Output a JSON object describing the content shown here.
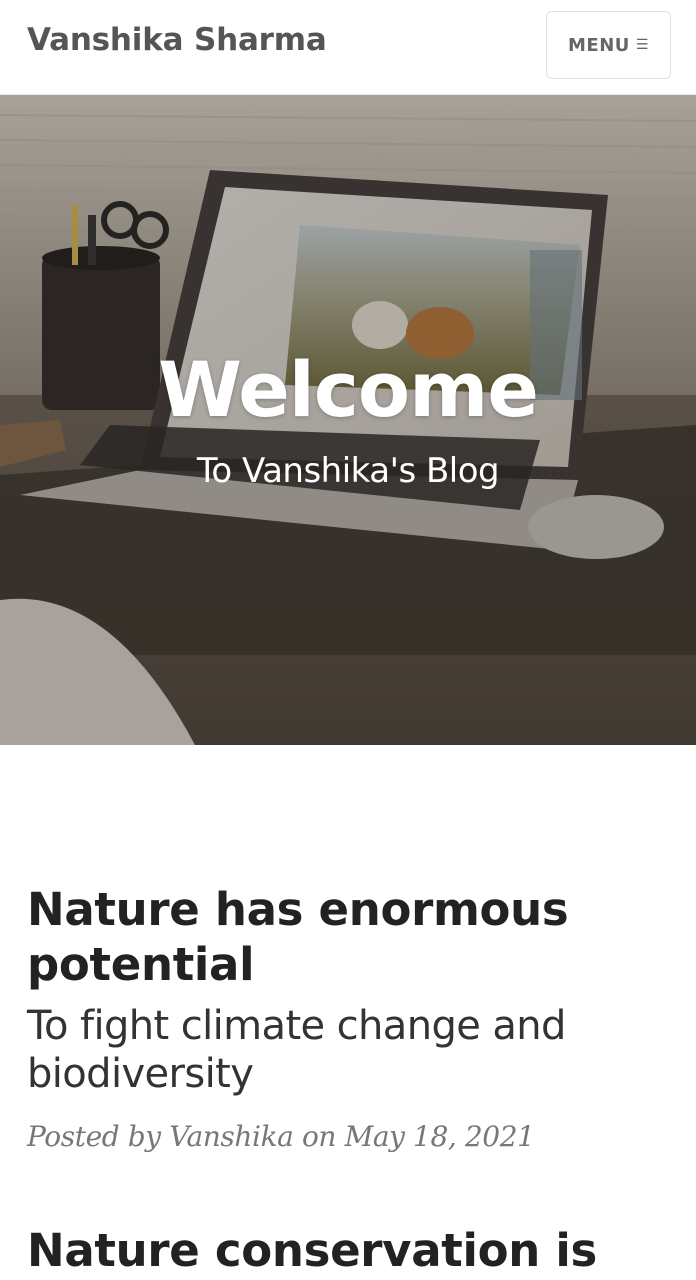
{
  "navbar": {
    "brand": "Vanshika Sharma",
    "menu_label": "MENU",
    "menu_icon": "bars-icon"
  },
  "hero": {
    "title": "Welcome",
    "subtitle": "To Vanshika's Blog"
  },
  "posts": [
    {
      "title": "Nature has enormous potential",
      "subtitle": "To fight climate change and biodiversity",
      "meta_prefix": "Posted by",
      "author": "Vanshika",
      "meta_on": "on",
      "date": "May 18, 2021"
    },
    {
      "title": "Nature conservation is"
    }
  ]
}
